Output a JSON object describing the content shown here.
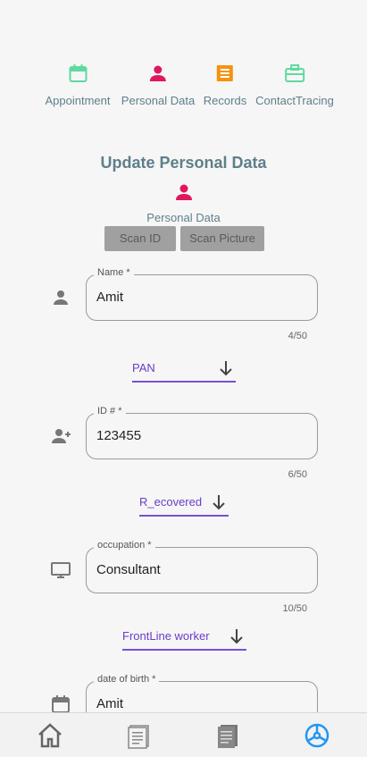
{
  "nav": {
    "items": [
      {
        "label": "Appointment",
        "icon": "calendar-icon",
        "color": "#5fd9a0"
      },
      {
        "label": "Personal Data",
        "icon": "person-icon",
        "color": "#e0175e"
      },
      {
        "label": "Records",
        "icon": "list-icon",
        "color": "#f5920f"
      },
      {
        "label": "ContactTracing",
        "icon": "briefcase-icon",
        "color": "#5fd9a0"
      }
    ]
  },
  "page": {
    "title": "Update Personal Data",
    "section_label": "Personal Data",
    "scan_id": "Scan ID",
    "scan_picture": "Scan Picture"
  },
  "form": {
    "name": {
      "label": "Name *",
      "value": "Amit",
      "counter": "4/50"
    },
    "id_type": {
      "value": "PAN"
    },
    "id": {
      "label": "ID # *",
      "value": "123455",
      "counter": "6/50"
    },
    "status": {
      "value": "R_ecovered"
    },
    "occupation": {
      "label": "occupation *",
      "value": "Consultant",
      "counter": "10/50"
    },
    "worker_type": {
      "value": "FrontLine worker"
    },
    "dob": {
      "label": "date of birth *",
      "value": "Amit"
    }
  },
  "bottom_nav": [
    "home-icon",
    "document-icon",
    "notes-icon",
    "settings-icon"
  ],
  "colors": {
    "accent": "#7b4fd6",
    "active": "#2196f3",
    "teal": "#5e7f8a"
  }
}
